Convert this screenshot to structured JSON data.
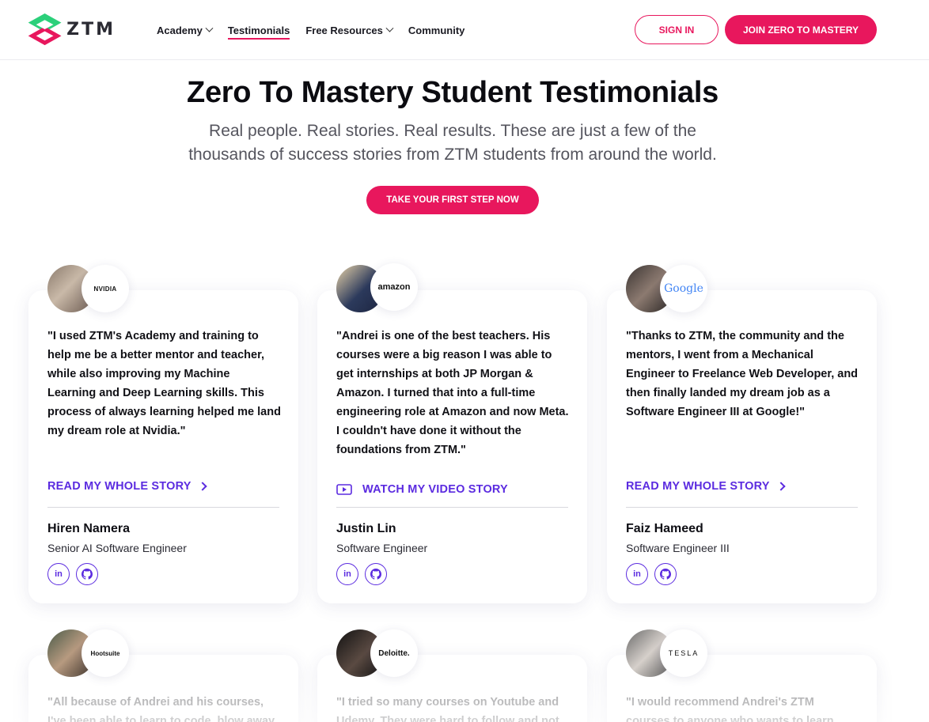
{
  "header": {
    "logo_text": "ZTM",
    "nav": [
      {
        "label": "Academy",
        "has_dropdown": true,
        "active": false
      },
      {
        "label": "Testimonials",
        "has_dropdown": false,
        "active": true
      },
      {
        "label": "Free Resources",
        "has_dropdown": true,
        "active": false
      },
      {
        "label": "Community",
        "has_dropdown": false,
        "active": false
      }
    ],
    "signin_label": "SIGN IN",
    "join_label": "JOIN ZERO TO MASTERY"
  },
  "hero": {
    "title": "Zero To Mastery Student Testimonials",
    "subtitle_line1": "Real people. Real stories. Real results. These are just a few of the",
    "subtitle_line2": "thousands of success stories from ZTM students from around the world.",
    "cta_label": "TAKE YOUR FIRST STEP NOW"
  },
  "testimonials": [
    {
      "company": "NVIDIA",
      "quote": "\"I used ZTM's Academy and training to help me be a better mentor and teacher, while also improving my Machine Learning and Deep Learning skills. This process of always learning helped me land my dream role at Nvidia.\"",
      "link_label": "READ MY WHOLE STORY",
      "link_type": "read",
      "name": "Hiren Namera",
      "role": "Senior AI Software Engineer"
    },
    {
      "company": "amazon",
      "quote": "\"Andrei is one of the best teachers. His courses were a big reason I was able to get internships at both JP Morgan & Amazon. I turned that into a full-time engineering role at Amazon and now Meta. I couldn't have done it without the foundations from ZTM.\"",
      "link_label": "WATCH MY VIDEO STORY",
      "link_type": "video",
      "name": "Justin Lin",
      "role": "Software Engineer"
    },
    {
      "company": "Google",
      "quote": "\"Thanks to ZTM, the community and the mentors, I went from a Mechanical Engineer to Freelance Web Developer, and then finally landed my dream job as a Software Engineer III at Google!\"",
      "link_label": "READ MY WHOLE STORY",
      "link_type": "read",
      "name": "Faiz Hameed",
      "role": "Software Engineer III"
    },
    {
      "company": "Hootsuite",
      "quote": "\"All because of Andrei and his courses, I've been able to learn to code, blow away"
    },
    {
      "company": "Deloitte.",
      "quote": "\"I tried so many courses on Youtube and Udemy. They were hard to follow and not"
    },
    {
      "company": "TESLA",
      "quote": "\"I would recommend Andrei's ZTM courses to anyone who wants to learn"
    }
  ],
  "social_labels": {
    "linkedin": "in"
  },
  "colors": {
    "brand_pink": "#e8175d",
    "link_purple": "#5b2be0",
    "logo_green": "#2bd07a"
  },
  "icons": [
    "chevron-down-icon",
    "chevron-right-icon",
    "play-icon",
    "linkedin-icon",
    "github-icon"
  ]
}
